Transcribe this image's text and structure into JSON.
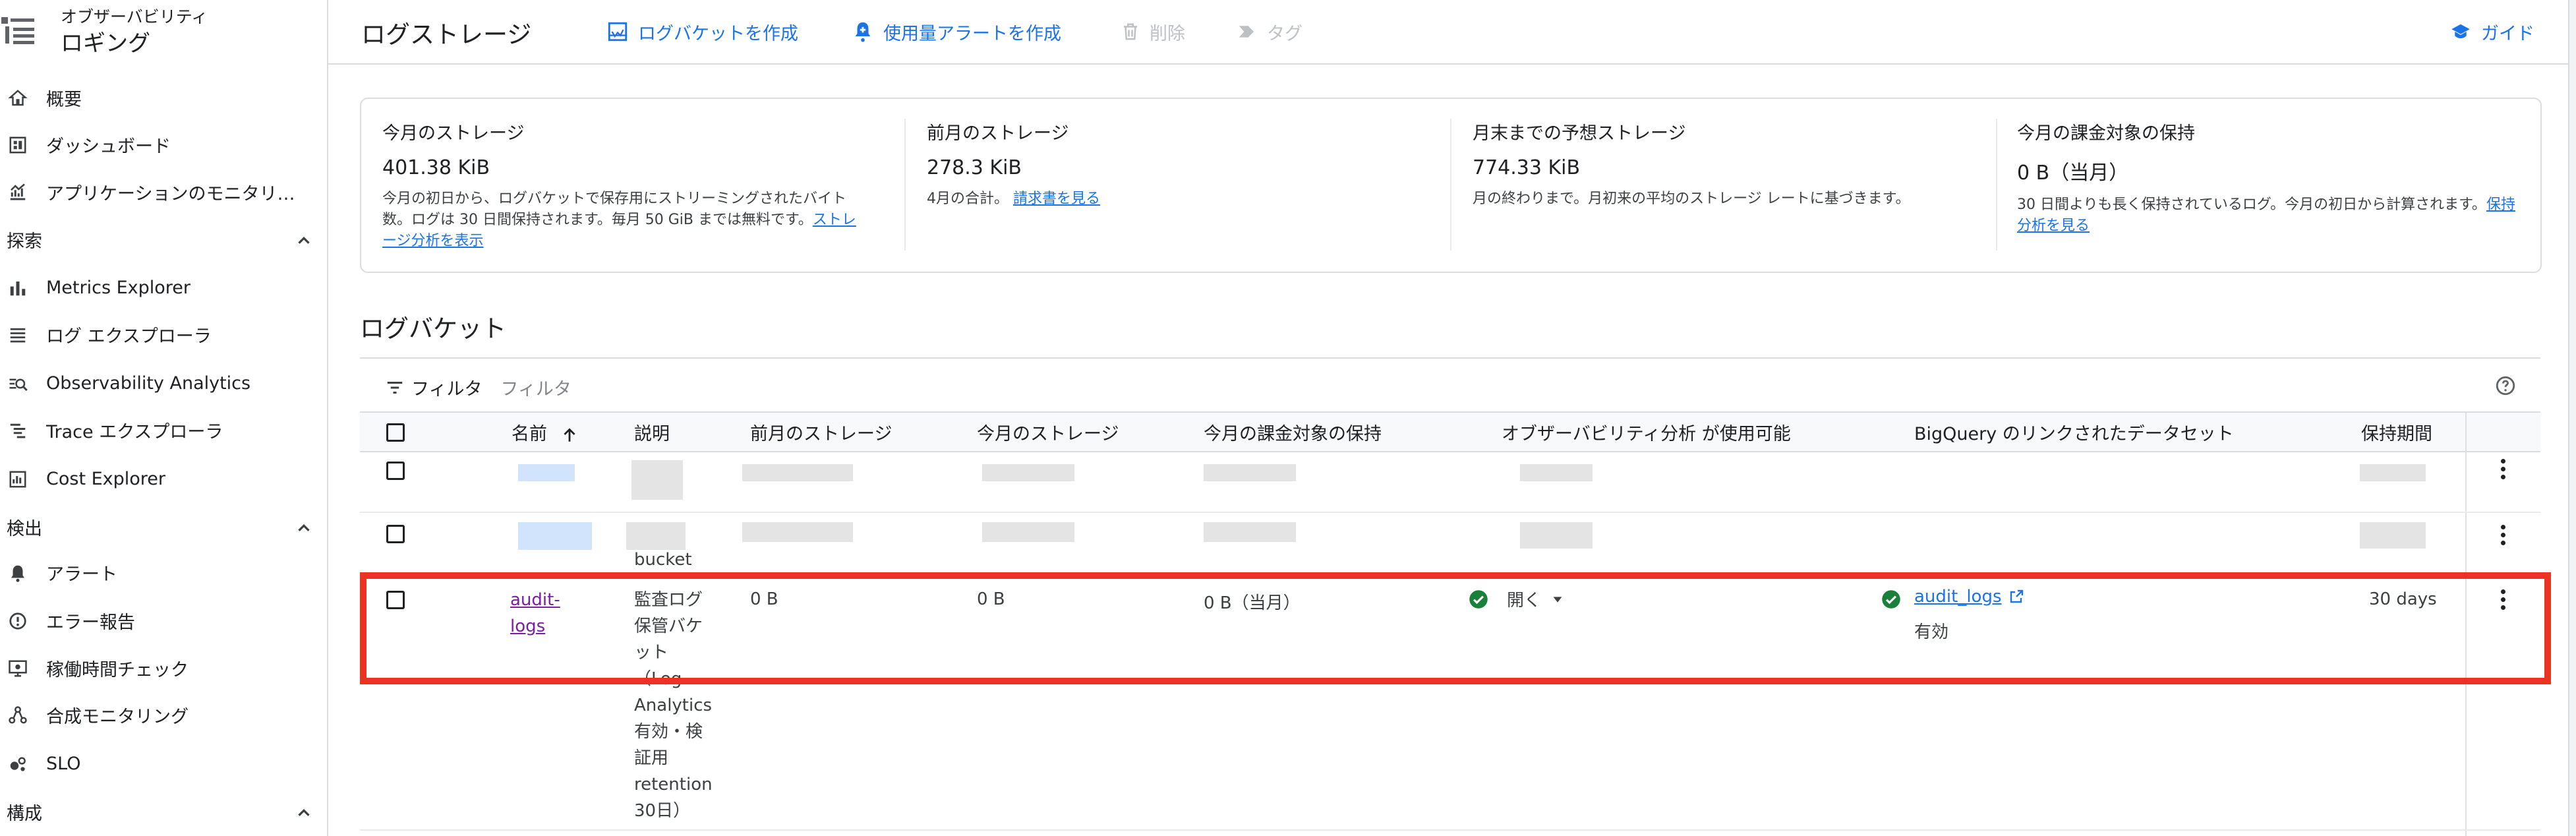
{
  "sidebar": {
    "app_subtitle": "オブザーバビリティ",
    "app_title": "ロギング",
    "top_items": [
      {
        "label": "概要",
        "icon": "home-icon"
      },
      {
        "label": "ダッシュボード",
        "icon": "dashboard-icon"
      },
      {
        "label": "アプリケーションのモニタリ…",
        "icon": "app-monitoring-icon"
      }
    ],
    "sections": [
      {
        "title": "探索",
        "items": [
          {
            "label": "Metrics Explorer",
            "icon": "bar-chart-icon"
          },
          {
            "label": "ログ エクスプローラ",
            "icon": "list-icon"
          },
          {
            "label": "Observability Analytics",
            "icon": "analytics-icon"
          },
          {
            "label": "Trace エクスプローラ",
            "icon": "trace-icon"
          },
          {
            "label": "Cost Explorer",
            "icon": "cost-icon"
          }
        ]
      },
      {
        "title": "検出",
        "items": [
          {
            "label": "アラート",
            "icon": "bell-icon"
          },
          {
            "label": "エラー報告",
            "icon": "error-icon"
          },
          {
            "label": "稼働時間チェック",
            "icon": "monitor-icon"
          },
          {
            "label": "合成モニタリング",
            "icon": "synthetic-icon"
          },
          {
            "label": "SLO",
            "icon": "slo-icon"
          }
        ]
      },
      {
        "title": "構成",
        "items": []
      }
    ]
  },
  "toolbar": {
    "title": "ログストレージ",
    "create_bucket": "ログバケットを作成",
    "create_alert": "使用量アラートを作成",
    "delete": "削除",
    "tag": "タグ",
    "guide": "ガイド"
  },
  "storage": {
    "current": {
      "title": "今月のストレージ",
      "value": "401.38 KiB",
      "desc": "今月の初日から、ログバケットで保存用にストリーミングされたバイト数。ログは 30 日間保持されます。毎月 50 GiB までは無料です。",
      "link": "ストレージ分析を表示"
    },
    "previous": {
      "title": "前月のストレージ",
      "value": "278.3 KiB",
      "desc": "4月の合計。",
      "link": "請求書を見る"
    },
    "projected": {
      "title": "月末までの予想ストレージ",
      "value": "774.33 KiB",
      "desc": "月の終わりまで。月初来の平均のストレージ レートに基づきます。"
    },
    "retention": {
      "title": "今月の課金対象の保持",
      "value": "0 B（当月）",
      "desc": "30 日間よりも長く保持されているログ。今月の初日から計算されます。",
      "link": "保持分析を見る"
    }
  },
  "buckets": {
    "title": "ログバケット",
    "filter_label": "フィルタ",
    "filter_placeholder": "フィルタ",
    "columns": [
      "名前",
      "説明",
      "前月のストレージ",
      "今月のストレージ",
      "今月の課金対象の保持",
      "オブザーバビリティ分析 が使用可能",
      "BigQuery のリンクされたデータセット",
      "保持期間"
    ],
    "overflow_text": "bucket",
    "row": {
      "name_line1": "audit-",
      "name_line2": "logs",
      "desc_lines": [
        "監査ログ",
        "保管バケ",
        "ット",
        "（Log",
        "Analytics",
        "有効・検",
        "証用",
        "retention",
        "30日）"
      ],
      "prev_storage": "0 B",
      "cur_storage": "0 B",
      "billable": "0 B（当月）",
      "analytics": "開く",
      "bq_dataset": "audit_logs",
      "bq_status": "有効",
      "retention": "30 days"
    }
  },
  "colors": {
    "accent": "#1a73e8",
    "link_visited": "#7b1fa2",
    "success": "#188038",
    "highlight": "#ea3323"
  }
}
